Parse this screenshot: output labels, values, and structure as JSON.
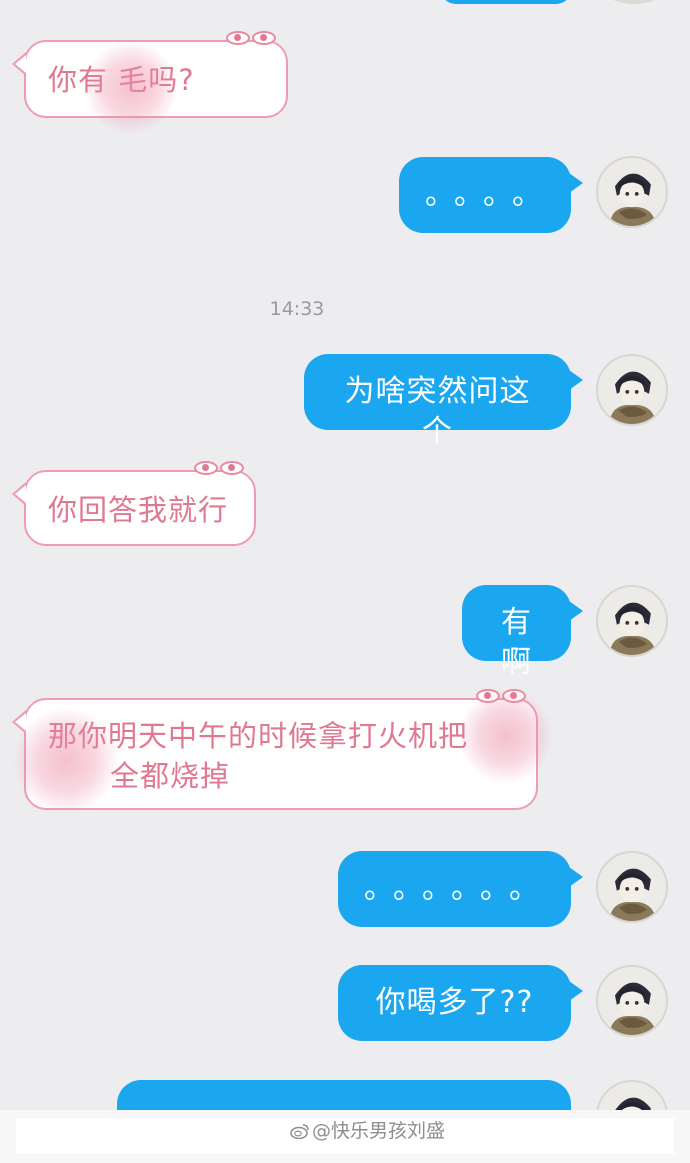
{
  "chat": {
    "timestamp": "14:33",
    "messages": [
      {
        "side": "left",
        "text": "你有  毛吗?"
      },
      {
        "side": "right",
        "text": "。。。。"
      },
      {
        "side": "right",
        "text": "为啥突然问这个"
      },
      {
        "side": "left",
        "text": "你回答我就行"
      },
      {
        "side": "right",
        "text": "有啊"
      },
      {
        "side": "left",
        "line1": "那你明天中午的时候拿打火机把",
        "line2": "全都烧掉"
      },
      {
        "side": "right",
        "text": "。。。。。。"
      },
      {
        "side": "right",
        "text": "你喝多了??"
      }
    ]
  },
  "footer": {
    "watermark": "@快乐男孩刘盛"
  },
  "colors": {
    "background": "#ededf0",
    "sent_bubble": "#1aa7ef",
    "received_border": "#ef9bb0",
    "received_text": "#e07892"
  },
  "icons": {
    "avatar": "anime-avatar-icon",
    "eyes": "peeking-eyes-icon",
    "weibo": "weibo-icon"
  }
}
